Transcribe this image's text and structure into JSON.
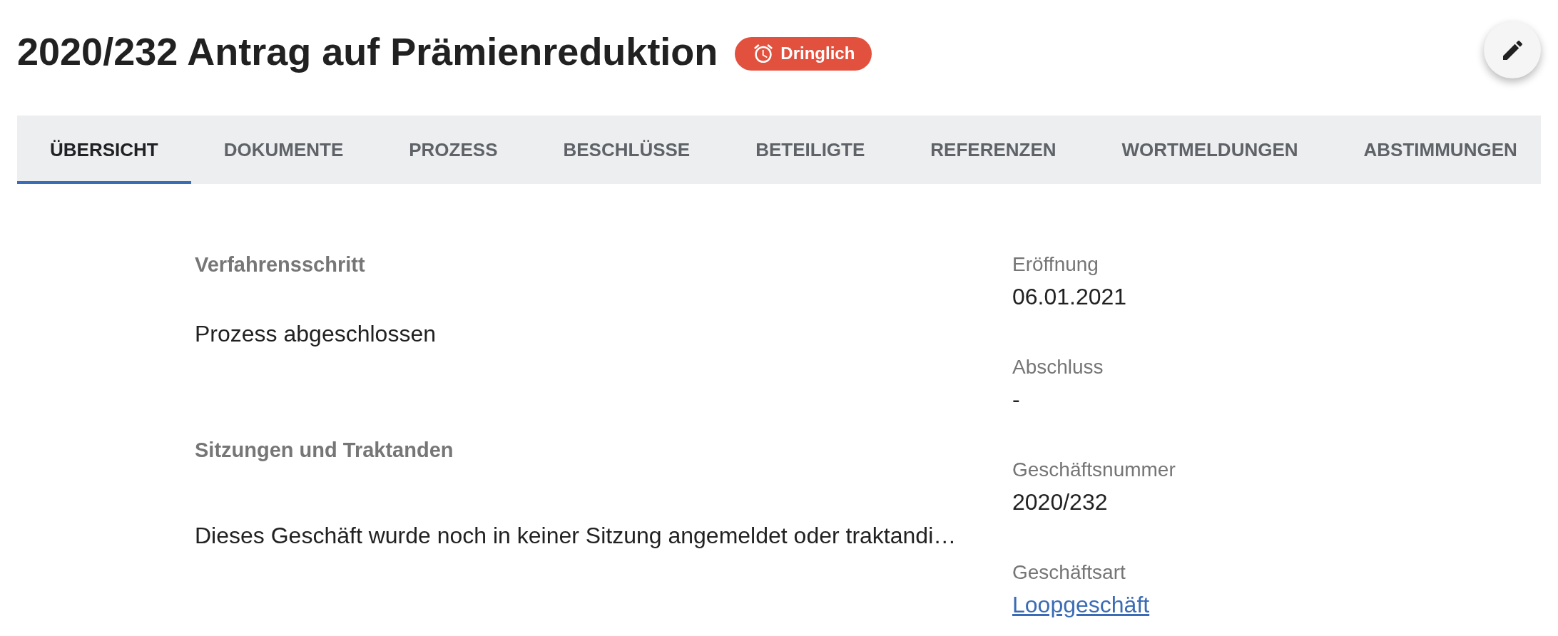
{
  "title": "2020/232 Antrag auf Prämienreduktion",
  "badge": {
    "label": "Dringlich"
  },
  "tabs": [
    {
      "label": "ÜBERSICHT",
      "selected": true
    },
    {
      "label": "DOKUMENTE",
      "selected": false
    },
    {
      "label": "PROZESS",
      "selected": false
    },
    {
      "label": "BESCHLÜSSE",
      "selected": false
    },
    {
      "label": "BETEILIGTE",
      "selected": false
    },
    {
      "label": "REFERENZEN",
      "selected": false
    },
    {
      "label": "WORTMELDUNGEN",
      "selected": false
    },
    {
      "label": "ABSTIMMUNGEN",
      "selected": false
    }
  ],
  "sections": [
    {
      "heading": "Verfahrensschritt",
      "text": "Prozess abgeschlossen"
    },
    {
      "heading": "Sitzungen und Traktanden",
      "text": "Dieses Geschäft wurde noch in keiner Sitzung angemeldet oder traktandi…"
    }
  ],
  "details": [
    {
      "label": "Eröffnung",
      "value": "06.01.2021",
      "kind": "text"
    },
    {
      "label": "Abschluss",
      "value": "-",
      "kind": "text"
    },
    {
      "label": "Geschäftsnummer",
      "value": "2020/232",
      "kind": "text"
    },
    {
      "label": "Geschäftsart",
      "value": "Loopgeschäft",
      "kind": "link"
    }
  ]
}
